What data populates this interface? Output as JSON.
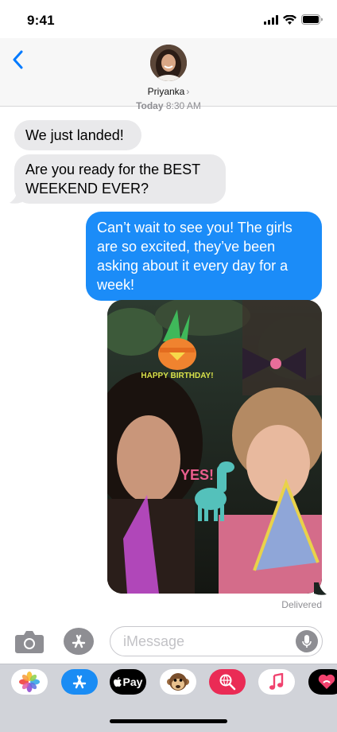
{
  "status": {
    "time": "9:41"
  },
  "header": {
    "contact_name": "Priyanka",
    "chevron": "›"
  },
  "timestamp": {
    "day": "Today",
    "time": "8:30 AM"
  },
  "messages": [
    {
      "direction": "incoming",
      "text": "We just landed!"
    },
    {
      "direction": "incoming",
      "text": "Are you ready for the BEST WEEKEND EVER?"
    },
    {
      "direction": "outgoing",
      "text": "Can’t wait to see you! The girls are so excited, they’ve been asking about it every day for a week!"
    },
    {
      "direction": "outgoing",
      "type": "photo",
      "stickers": [
        "HAPPY BIRTHDAY!",
        "YES!"
      ]
    }
  ],
  "delivery_status": "Delivered",
  "input": {
    "placeholder": "iMessage",
    "value": ""
  },
  "app_drawer": {
    "apps": [
      {
        "name": "photos-app-icon",
        "label": ""
      },
      {
        "name": "app-store-icon",
        "label": ""
      },
      {
        "name": "apple-pay-app",
        "label": "Pay"
      },
      {
        "name": "animoji-app-icon",
        "label": ""
      },
      {
        "name": "image-search-app-icon",
        "label": ""
      },
      {
        "name": "music-app-icon",
        "label": ""
      },
      {
        "name": "digital-touch-app-icon",
        "label": ""
      }
    ]
  },
  "colors": {
    "outgoing_bubble": "#1b8cf8",
    "incoming_bubble": "#e9e9eb",
    "ios_blue": "#007aff",
    "drawer_bg": "#d1d3d9"
  }
}
